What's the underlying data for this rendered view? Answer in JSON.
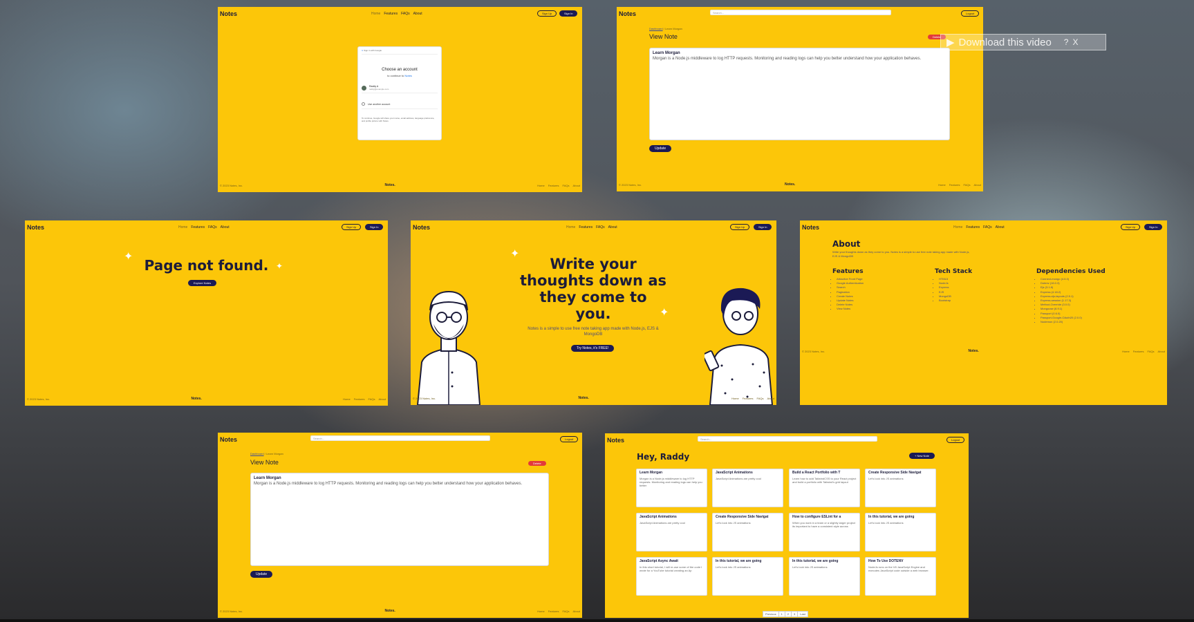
{
  "brand": "Notes",
  "nav": [
    "Home",
    "Features",
    "FAQs",
    "About"
  ],
  "btn_signup": "Sign Up",
  "btn_signin": "Sign In",
  "btn_logout": "Logout",
  "footer_copy": "© 2023 Notes, Inc.",
  "footer_logo": "Notes.",
  "search_placeholder": "Search...",
  "google": {
    "header": "Sign in with Google",
    "title": "Choose an account",
    "sub_prefix": "to continue to",
    "sub_app": "Notes",
    "acct_name": "Raddy A",
    "acct_email": "raddy@example.com",
    "other": "Use another account",
    "disclaimer": "To continue, Google will share your name, email address, language preference, and profile picture with Notes."
  },
  "view_note": {
    "crumb_link": "Dashboard",
    "crumb_sep": "/",
    "crumb_current": "Learn Morgan",
    "title": "View Note",
    "delete": "Delete",
    "note_title": "Learn Morgan",
    "note_body": "Morgan is a Node.js middleware to log HTTP requests. Monitoring and reading logs can help you better understand how your application behaves.",
    "update": "Update"
  },
  "download_banner": {
    "text": "Download this video",
    "help": "?",
    "close": "X"
  },
  "not_found": {
    "title": "Page not found.",
    "button": "Explore Notes"
  },
  "home": {
    "headline": "Write your thoughts down as they come to you.",
    "sub": "Notes is a simple to use free note taking app made with Node.js, EJS & MongoDB",
    "cta": "Try Notes, it's FREE!"
  },
  "about": {
    "title": "About",
    "intro": "Write your thoughts down as they come to you. Notes is a simple to use free note taking app made with Node.js, EJS & MongoDB",
    "features_h": "Features",
    "features": [
      "Attractive Front Page",
      "Google Authentication",
      "Search",
      "Pagination",
      "Create Notes",
      "Update Notes",
      "Delete Notes",
      "View Notes"
    ],
    "tech_h": "Tech Stack",
    "tech": [
      "HTML5",
      "NodeJs",
      "Express",
      "EJS",
      "MongoDB",
      "Bootstrap"
    ],
    "deps_h": "Dependencies Used",
    "deps": [
      "Connect-mongo (4.6.0)",
      "Dotenv (16.0.3)",
      "Ejs (3.1.8)",
      "Express (4.18.2)",
      "Express-ejs-layouts (2.5.1)",
      "Express-session (1.17.3)",
      "Method-Override (3.0.0)",
      "Mongoose (6.9.1)",
      "Passport (0.6.0)",
      "Passport-Google-OAuth20 (2.0.0)",
      "Nodemon (2.0.20)"
    ]
  },
  "dashboard": {
    "greeting": "Hey, Raddy",
    "new_note": "+ New Note",
    "cards": [
      {
        "t": "Learn Morgan",
        "b": "Morgan is a Node.js middleware to log HTTP requests. Monitoring and reading logs can help you better"
      },
      {
        "t": "JavaScript Animations",
        "b": "JavaScript Animations are pretty cool"
      },
      {
        "t": "Build a React Portfolio with T",
        "b": "Learn how to add TailwindCSS to your React project and build a portfolio with Tailwind's grid layout"
      },
      {
        "t": "Create Responsive Side Navigat",
        "b": "Let's look into JS animations"
      },
      {
        "t": "JavaScript Animations",
        "b": "JavaScript Animations are pretty cool"
      },
      {
        "t": "Create Responsive Side Navigat",
        "b": "Let's look into JS animations"
      },
      {
        "t": "How to configure ESLint for a",
        "b": "When you work in a team or a slightly larger project its important to have a consistent style across"
      },
      {
        "t": "In this tutorial, we are going",
        "b": "Let's look into JS animations"
      },
      {
        "t": "JavaScript Async Await",
        "b": "In this short tutorial, I will re-use some of the code I wrote for a YouTube tutorial creating an Ap"
      },
      {
        "t": "In this tutorial, we are going",
        "b": "Let's look into JS animations"
      },
      {
        "t": "In this tutorial, we are going",
        "b": "Let's look into JS animations"
      },
      {
        "t": "How To Use DOTENV",
        "b": "NodeJs runs on the V8 JavaScript Engine and executes JavaScript code outside a web browser."
      }
    ],
    "pagination": [
      "Previous",
      "1",
      "2",
      "3",
      "Last"
    ]
  },
  "colors": {
    "yellow": "#fcc609",
    "navy": "#1b1a55",
    "red": "#e23a3a"
  }
}
